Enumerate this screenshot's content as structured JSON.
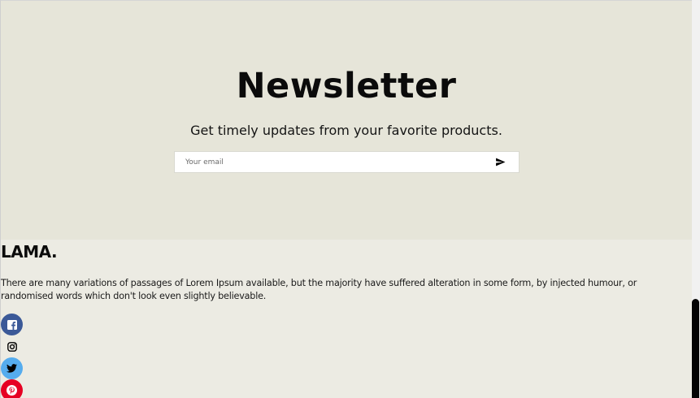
{
  "newsletter": {
    "title": "Newsletter",
    "description": "Get timely updates from your favorite products.",
    "email_placeholder": "Your email",
    "email_value": "",
    "send_icon": "send-icon"
  },
  "footer": {
    "logo": "LAMA.",
    "description": "There are many variations of passages of Lorem Ipsum available, but the majority have suffered alteration in some form, by injected humour, or randomised words which don't look even slightly believable.",
    "social": [
      {
        "icon": "facebook-icon",
        "color": "#3b5998"
      },
      {
        "icon": "instagram-icon",
        "color": "#ecebe3"
      },
      {
        "icon": "twitter-icon",
        "color": "#55acee"
      },
      {
        "icon": "pinterest-icon",
        "color": "#e60023"
      }
    ]
  },
  "colors": {
    "newsletter_bg": "#e6e5d9",
    "footer_bg": "#ecebe3",
    "text": "#0b0b0b"
  }
}
